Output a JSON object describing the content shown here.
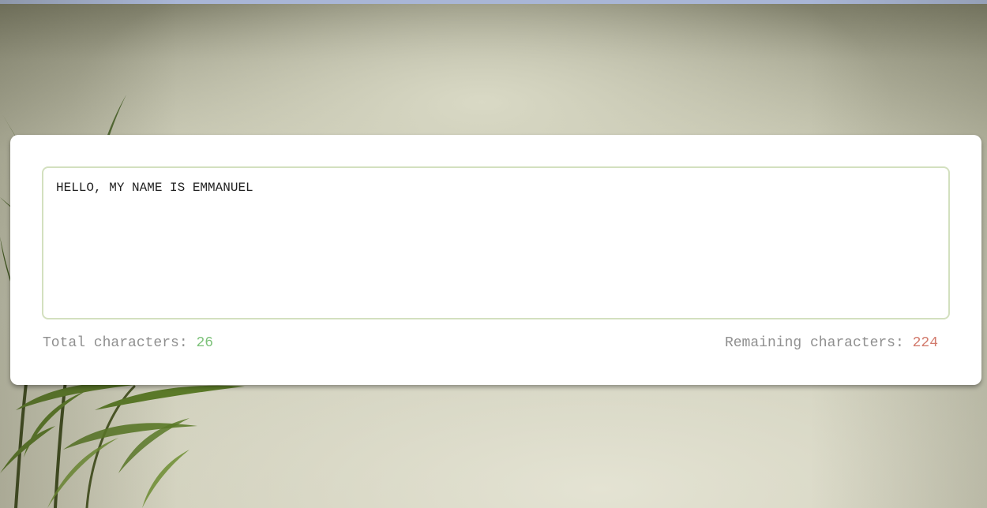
{
  "editor": {
    "text": "HELLO, MY NAME IS EMMANUEL"
  },
  "counters": {
    "total_label": "Total characters: ",
    "total_value": "26",
    "remaining_label": "Remaining characters: ",
    "remaining_value": "224"
  },
  "colors": {
    "total_value": "#7dc27a",
    "remaining_value": "#d27a6c",
    "textarea_border": "#d3e0bf",
    "top_strip": "#a9b6d6"
  }
}
